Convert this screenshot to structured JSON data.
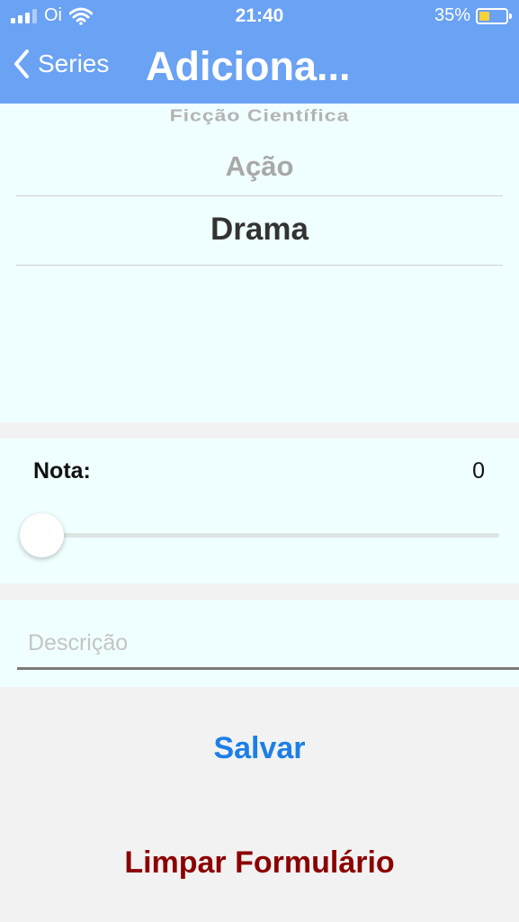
{
  "status_bar": {
    "carrier": "Oi",
    "time": "21:40",
    "battery_percent": "35%",
    "signal_bars": 3,
    "signal_bars_total": 4
  },
  "nav": {
    "back_label": "Series",
    "title": "Adiciona..."
  },
  "genre_picker": {
    "items": [
      "Ficção Científica",
      "Ação",
      "Drama"
    ],
    "selected": "Drama"
  },
  "rating": {
    "label": "Nota:",
    "value": "0",
    "slider_fraction": 0
  },
  "description": {
    "placeholder": "Descrição",
    "value": ""
  },
  "actions": {
    "save_label": "Salvar",
    "clear_label": "Limpar Formulário"
  },
  "colors": {
    "header_bg": "#6aa2f4",
    "panel_bg": "#f0ffff",
    "page_bg": "#f2f2f2",
    "save_color": "#1c7fe6",
    "clear_color": "#8b0000",
    "battery_fill": "#f5d33b"
  }
}
